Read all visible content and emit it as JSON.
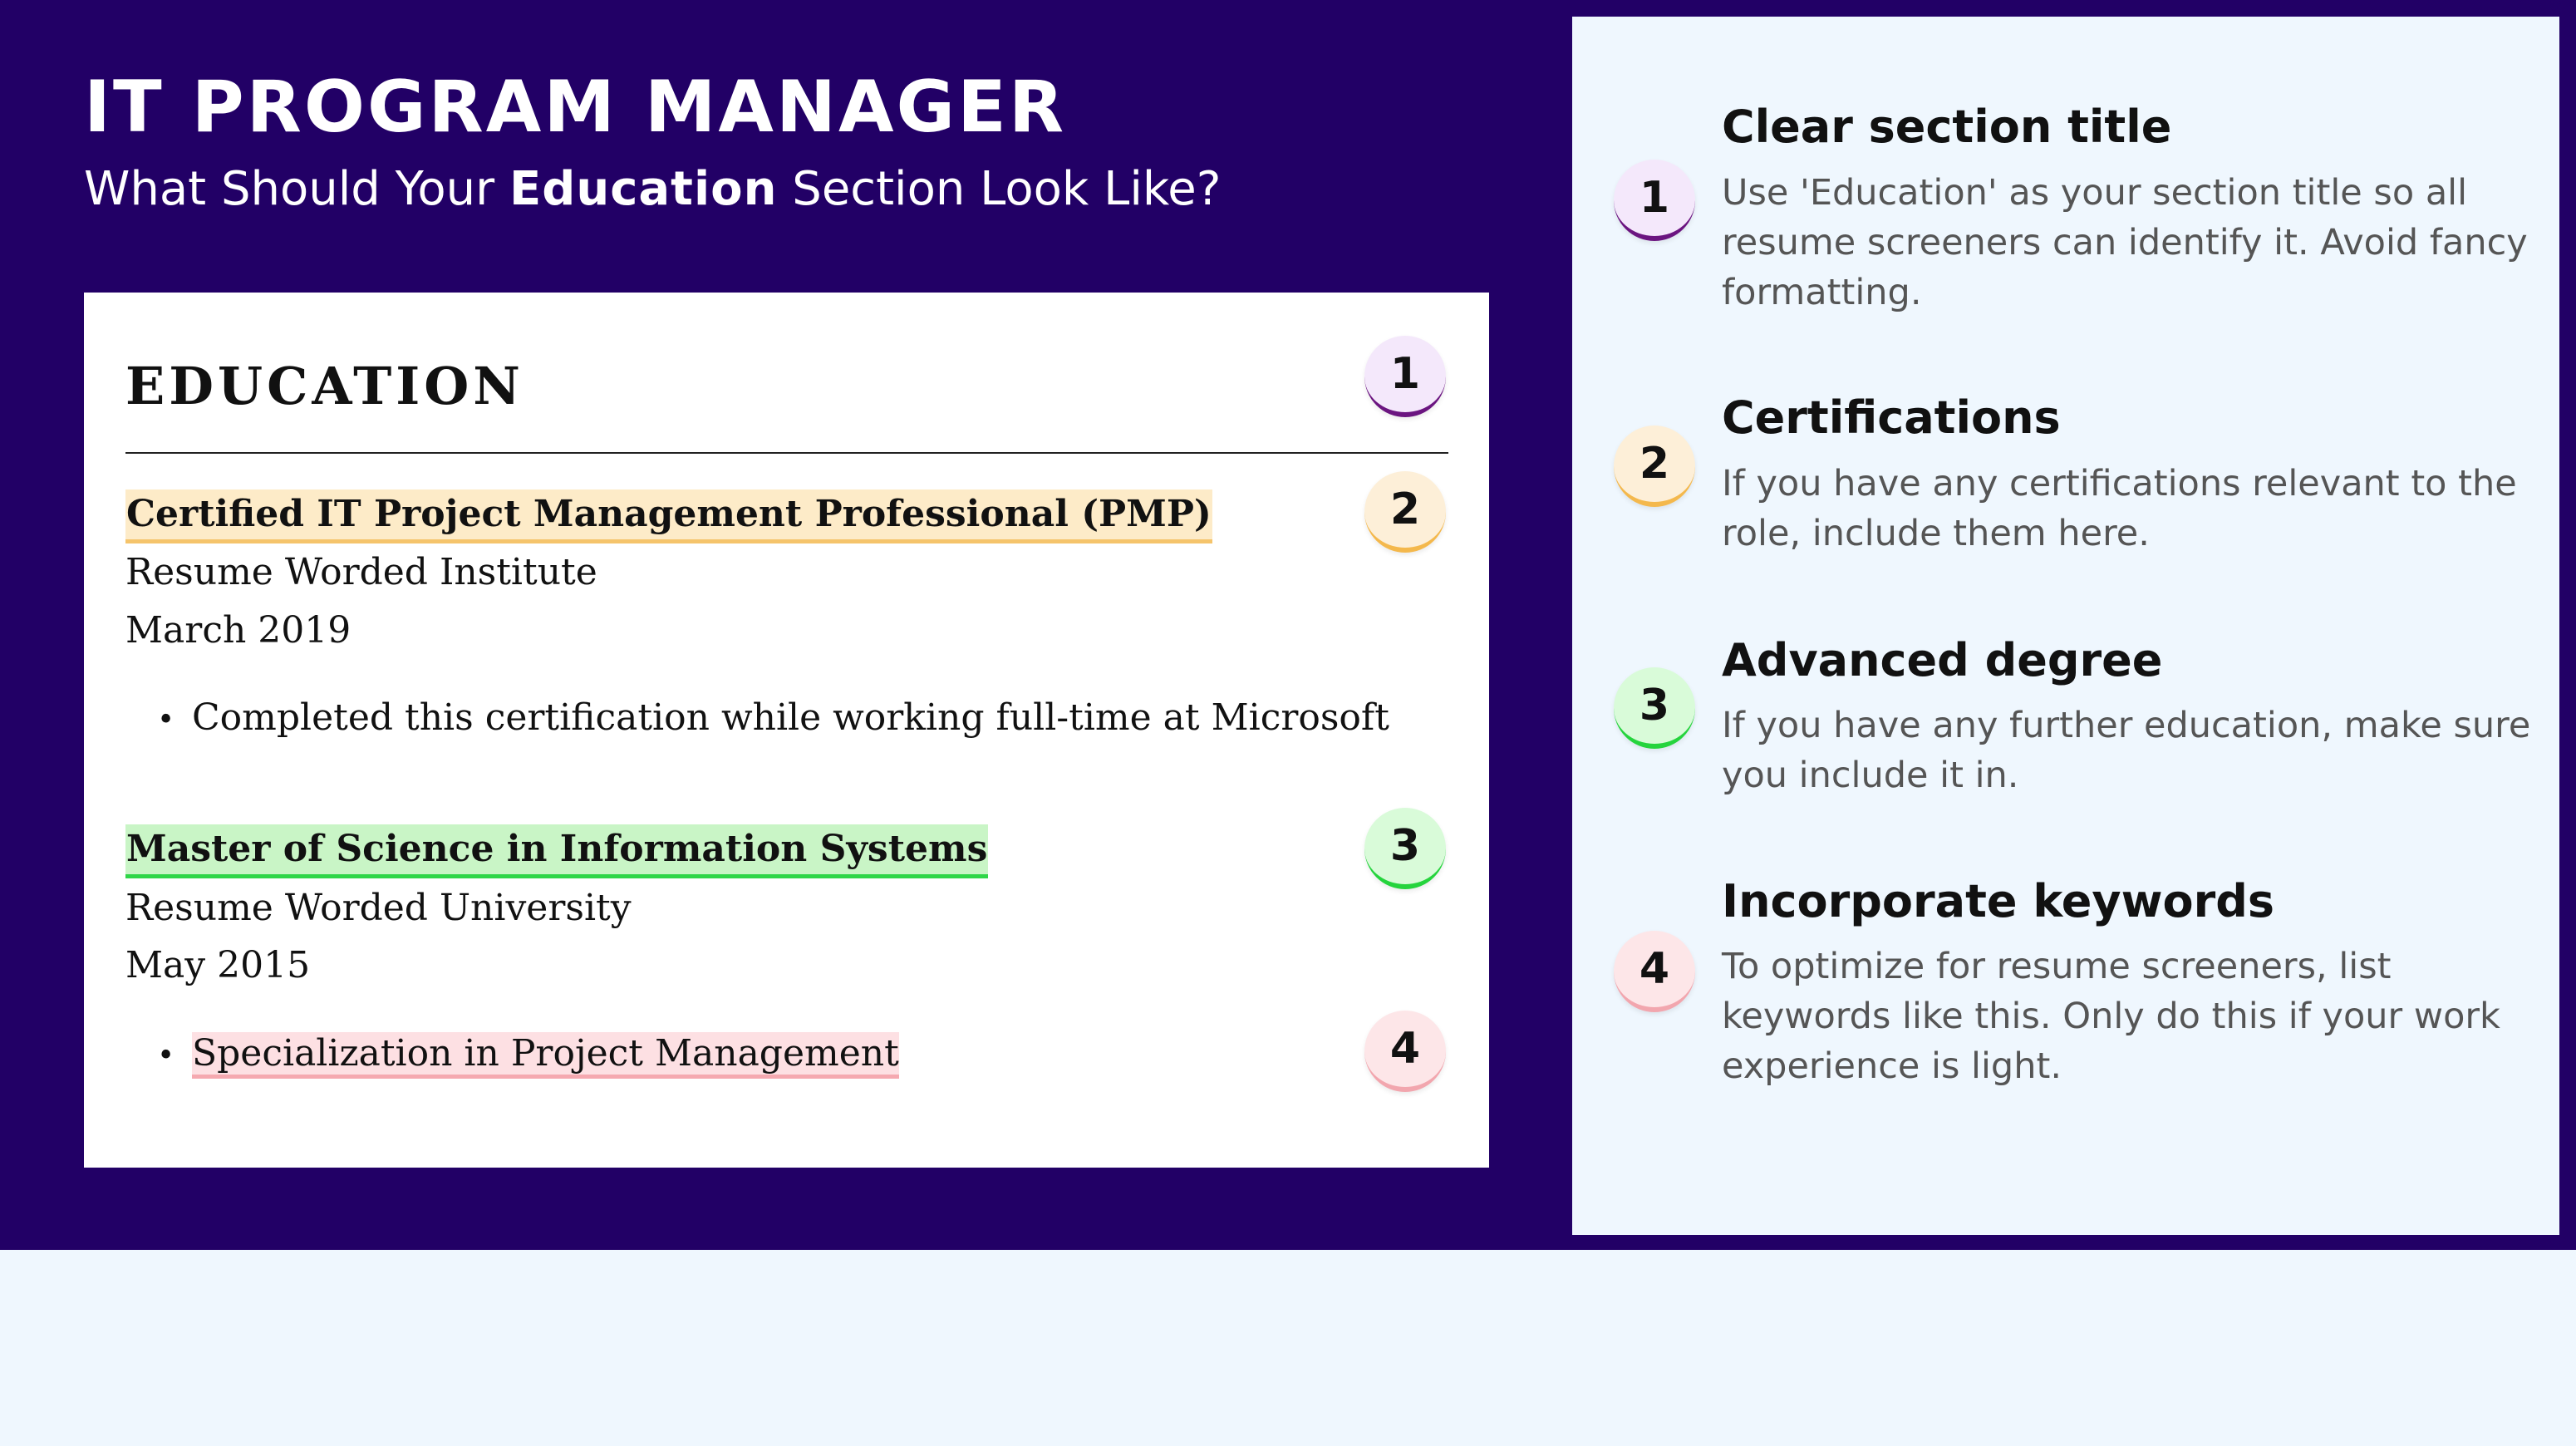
{
  "header": {
    "title": "IT PROGRAM MANAGER",
    "subtitle_before": "What Should Your ",
    "subtitle_bold": "Education",
    "subtitle_after": " Section Look Like?"
  },
  "resume": {
    "section_heading": "EDUCATION",
    "entries": [
      {
        "title": "Certified IT Project Management Professional (PMP)",
        "institution": "Resume Worded Institute",
        "date": "March 2019",
        "bullet": "Completed this certification while working full-time at Microsoft"
      },
      {
        "title": "Master of Science in Information Systems",
        "institution": "Resume Worded University",
        "date": "May 2015",
        "bullet": "Specialization in Project Management"
      }
    ],
    "badges": [
      "1",
      "2",
      "3",
      "4"
    ]
  },
  "tips": [
    {
      "number": "1",
      "title": "Clear section title",
      "body": "Use 'Education' as your section title so all resume screeners can identify it. Avoid fancy formatting."
    },
    {
      "number": "2",
      "title": "Certifications",
      "body": "If you have any certifications relevant to the role, include them here."
    },
    {
      "number": "3",
      "title": "Advanced degree",
      "body": "If you have any further education, make sure you include it in."
    },
    {
      "number": "4",
      "title": "Incorporate keywords",
      "body": "To optimize for resume screeners, list keywords like this. Only do this if your work experience is light."
    }
  ],
  "colors": {
    "banner": "#220066",
    "panel": "#eff7fe",
    "highlight_orange": "#f5c46b",
    "highlight_green": "#2fd648",
    "highlight_pink": "#f5a9b0",
    "badge_purple": "#6b1580"
  }
}
